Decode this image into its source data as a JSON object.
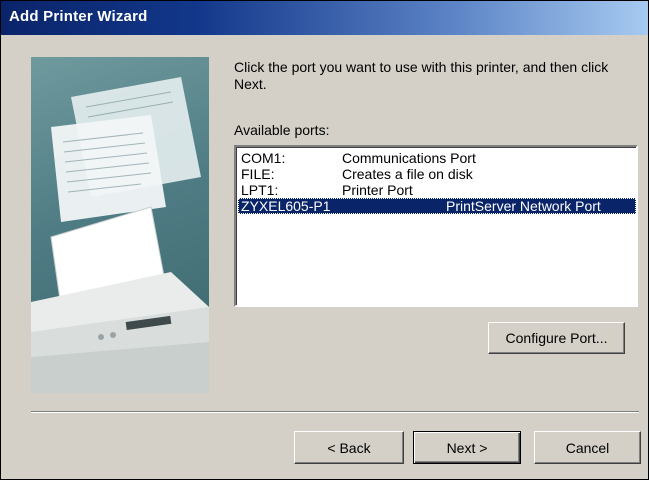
{
  "window": {
    "title": "Add Printer Wizard"
  },
  "instructions": "Click the port you want to use with this printer, and then click Next.",
  "available_ports_label": "Available ports:",
  "ports": [
    {
      "port": "COM1:",
      "description": "Communications Port",
      "selected": false
    },
    {
      "port": "FILE:",
      "description": "Creates a file on disk",
      "selected": false
    },
    {
      "port": "LPT1:",
      "description": "Printer Port",
      "selected": false
    },
    {
      "port": "ZYXEL605-P1",
      "description": "PrintServer Network Port",
      "selected": true
    }
  ],
  "buttons": {
    "configure_port": "Configure Port...",
    "back": "< Back",
    "next": "Next >",
    "cancel": "Cancel"
  },
  "colors": {
    "title_bar": "#0a246a",
    "dialog_face": "#d4d0c8",
    "selection": "#0a246a"
  }
}
